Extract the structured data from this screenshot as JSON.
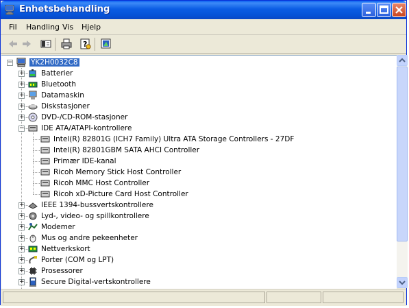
{
  "window": {
    "title": "Enhetsbehandling",
    "title_icon": "computer-management-icon"
  },
  "menu": {
    "items": [
      "Fil",
      "Handling",
      "Vis",
      "Hjelp"
    ]
  },
  "toolbar": {
    "buttons": [
      "back-arrow-icon",
      "forward-arrow-icon",
      "properties-panel-icon",
      "print-icon",
      "help-icon",
      "scan-hardware-icon"
    ]
  },
  "tree": {
    "root": "YK2H0032C8",
    "categories": [
      {
        "label": "Batterier",
        "icon": "battery-icon",
        "expanded": false
      },
      {
        "label": "Bluetooth",
        "icon": "bluetooth-icon",
        "expanded": false
      },
      {
        "label": "Datamaskin",
        "icon": "computer-icon",
        "expanded": false
      },
      {
        "label": "Diskstasjoner",
        "icon": "disk-drive-icon",
        "expanded": false
      },
      {
        "label": "DVD-/CD-ROM-stasjoner",
        "icon": "dvd-drive-icon",
        "expanded": false
      },
      {
        "label": "IDE ATA/ATAPI-kontrollere",
        "icon": "ide-controller-icon",
        "expanded": true,
        "children": [
          "Intel(R) 82801G (ICH7 Family) Ultra ATA Storage Controllers - 27DF",
          "Intel(R) 82801GBM SATA AHCI Controller",
          "Primær IDE-kanal",
          "Ricoh Memory Stick Host Controller",
          "Ricoh MMC Host Controller",
          "Ricoh xD-Picture Card Host Controller"
        ]
      },
      {
        "label": "IEEE 1394-bussvertskontrollere",
        "icon": "ieee1394-icon",
        "expanded": false
      },
      {
        "label": "Lyd-, video- og spillkontrollere",
        "icon": "sound-icon",
        "expanded": false
      },
      {
        "label": "Modemer",
        "icon": "modem-icon",
        "expanded": false
      },
      {
        "label": "Mus og andre pekeenheter",
        "icon": "mouse-icon",
        "expanded": false
      },
      {
        "label": "Nettverkskort",
        "icon": "network-card-icon",
        "expanded": false
      },
      {
        "label": "Porter (COM og LPT)",
        "icon": "port-icon",
        "expanded": false
      },
      {
        "label": "Prosessorer",
        "icon": "processor-icon",
        "expanded": false
      },
      {
        "label": "Secure Digital-vertskontrollere",
        "icon": "sd-host-icon",
        "expanded": false
      }
    ]
  },
  "colors": {
    "titlebar": "#0a5ee8",
    "selection": "#316ac5",
    "chrome": "#ece9d8"
  }
}
